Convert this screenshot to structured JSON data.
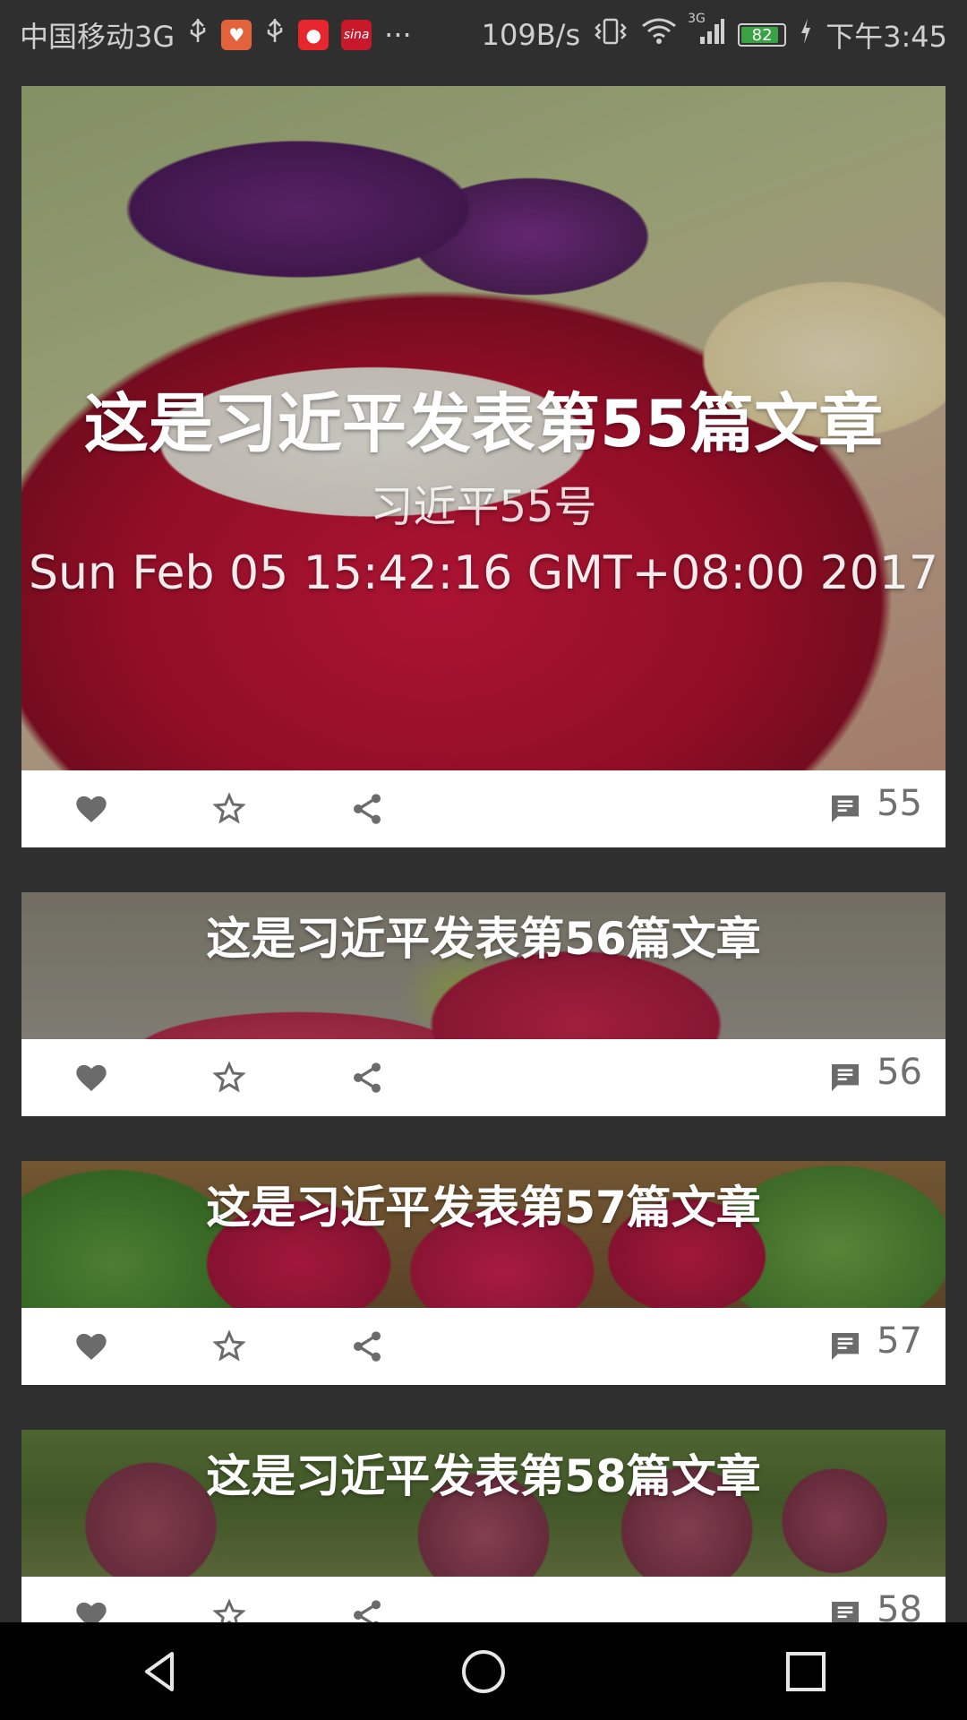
{
  "status_bar": {
    "carrier": "中国移动3G",
    "net_speed": "109B/s",
    "battery": "82",
    "signal_type": "3G",
    "time": "下午3:45",
    "more": "···",
    "icons": [
      "usb-icon",
      "app-icon",
      "usb-icon",
      "weibo-icon",
      "sina-icon",
      "vibrate-icon",
      "wifi-icon",
      "signal-icon",
      "battery-icon",
      "charging-icon"
    ]
  },
  "cards": [
    {
      "title": "这是习近平发表第55篇文章",
      "subtitle": "习近平55号",
      "date": "Sun Feb 05 15:42:16 GMT+08:00 2017",
      "comment_count": "55"
    },
    {
      "title": "这是习近平发表第56篇文章",
      "comment_count": "56"
    },
    {
      "title": "这是习近平发表第57篇文章",
      "comment_count": "57"
    },
    {
      "title": "这是习近平发表第58篇文章",
      "comment_count": "58"
    }
  ],
  "action_icons": [
    "heart-icon",
    "star-icon",
    "share-icon",
    "comment-icon"
  ],
  "colors": {
    "background": "#2f2f2f",
    "card": "#ffffff",
    "icon": "#6b6b6b",
    "nav_bar": "#000000"
  },
  "nav_bar": {
    "buttons": [
      "back-icon",
      "home-icon",
      "recents-icon"
    ]
  }
}
